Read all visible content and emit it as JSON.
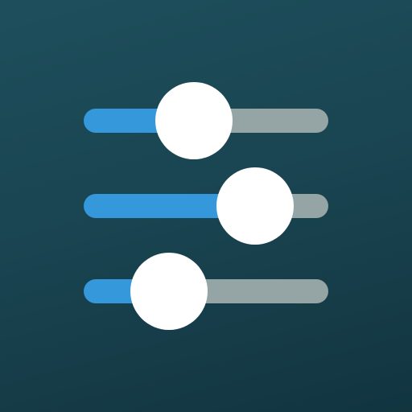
{
  "icon": {
    "name": "sliders-icon",
    "colors": {
      "background_top": "#1e4e5c",
      "background_bottom": "#123540",
      "active_track": "#3498db",
      "inactive_track": "#95a5a6",
      "knob": "#ffffff"
    },
    "sliders": [
      {
        "name": "slider-1",
        "level": 0.45
      },
      {
        "name": "slider-2",
        "level": 0.7
      },
      {
        "name": "slider-3",
        "level": 0.35
      }
    ]
  }
}
